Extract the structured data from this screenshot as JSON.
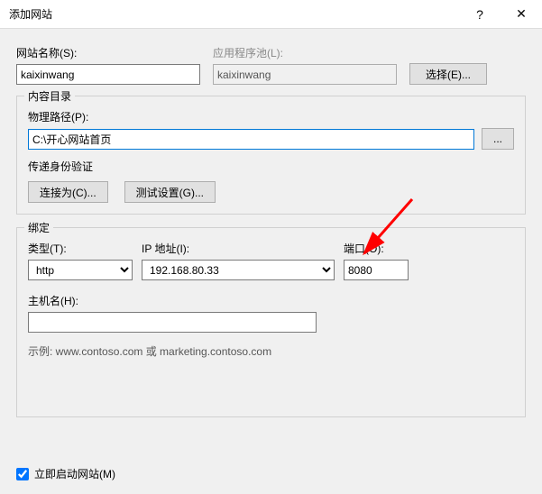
{
  "titlebar": {
    "title": "添加网站",
    "help": "?",
    "close": "✕"
  },
  "siteName": {
    "label": "网站名称(S):",
    "value": "kaixinwang"
  },
  "appPool": {
    "label": "应用程序池(L):",
    "value": "kaixinwang",
    "selectBtn": "选择(E)..."
  },
  "contentDir": {
    "legend": "内容目录",
    "physPathLabel": "物理路径(P):",
    "physPathValue": "C:\\开心网站首页",
    "browseBtn": "...",
    "passAuthLabel": "传递身份验证",
    "connectAsBtn": "连接为(C)...",
    "testBtn": "测试设置(G)..."
  },
  "binding": {
    "legend": "绑定",
    "typeLabel": "类型(T):",
    "typeValue": "http",
    "ipLabel": "IP 地址(I):",
    "ipValue": "192.168.80.33",
    "portLabel": "端口(O):",
    "portValue": "8080",
    "hostLabel": "主机名(H):",
    "hostValue": "",
    "example": "示例: www.contoso.com 或 marketing.contoso.com"
  },
  "footer": {
    "startNow": "立即启动网站(M)"
  }
}
